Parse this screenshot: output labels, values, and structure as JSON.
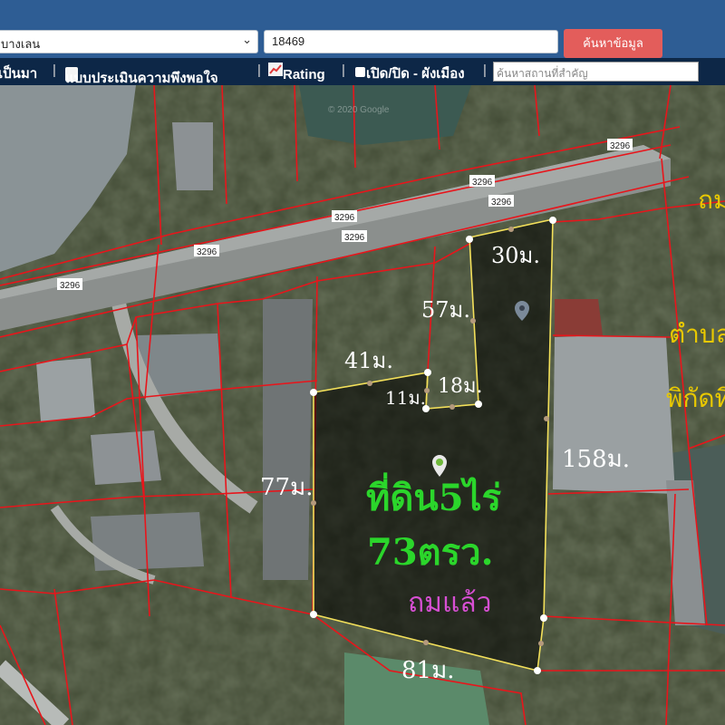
{
  "header": {
    "district_select": "บางเลน",
    "parcel_number": "18469",
    "search_button": "ค้นหาข้อมูล"
  },
  "toolbar": {
    "history_label": "เป็นมา",
    "survey_label": "แบบประเมินความพึงพอใจ",
    "rating_label": "Rating",
    "toggle_label": "เปิด/ปิด - ผังเมือง",
    "place_search_placeholder": "ค้นหาสถานที่สำคัญ"
  },
  "map": {
    "road_labels": [
      "3296",
      "3296",
      "3296",
      "3296",
      "3296",
      "3296",
      "3296"
    ],
    "watermark": "© 2020 Google",
    "annotations": {
      "top_width": "30ม.",
      "left_upper": "57ม.",
      "left_mid": "41ม.",
      "notch_a": "11ม.",
      "notch_b": "18ม.",
      "right_side": "158ม.",
      "left_side": "77ม.",
      "bottom": "81ม.",
      "area_line1": "ที่ดิน5ไร่",
      "area_line2": "73ตรว.",
      "status": "ถมแล้ว",
      "edge_top": "ถม",
      "edge_mid": "ตำบล",
      "edge_low": "พิกัดที่"
    }
  },
  "colors": {
    "header_bg": "#2e5d94",
    "toolbar_bg": "#0d2747",
    "button_bg": "#e35d5b",
    "parcel_line": "#e8151b",
    "plot_outline": "#f3e05a",
    "area_text": "#2bd62b",
    "status_text": "#d64fd2",
    "edge_text": "#e8c800",
    "annotation_text": "#ffffff"
  }
}
